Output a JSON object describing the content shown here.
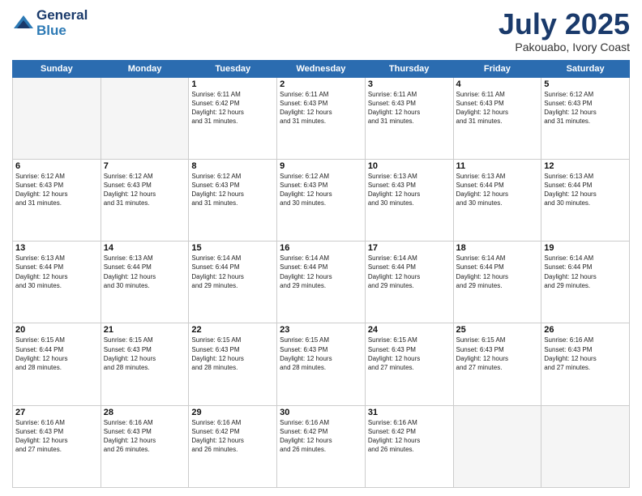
{
  "header": {
    "logo_line1": "General",
    "logo_line2": "Blue",
    "month_title": "July 2025",
    "location": "Pakouabo, Ivory Coast"
  },
  "weekdays": [
    "Sunday",
    "Monday",
    "Tuesday",
    "Wednesday",
    "Thursday",
    "Friday",
    "Saturday"
  ],
  "weeks": [
    [
      {
        "day": "",
        "empty": true
      },
      {
        "day": "",
        "empty": true
      },
      {
        "day": "1",
        "lines": [
          "Sunrise: 6:11 AM",
          "Sunset: 6:42 PM",
          "Daylight: 12 hours",
          "and 31 minutes."
        ]
      },
      {
        "day": "2",
        "lines": [
          "Sunrise: 6:11 AM",
          "Sunset: 6:43 PM",
          "Daylight: 12 hours",
          "and 31 minutes."
        ]
      },
      {
        "day": "3",
        "lines": [
          "Sunrise: 6:11 AM",
          "Sunset: 6:43 PM",
          "Daylight: 12 hours",
          "and 31 minutes."
        ]
      },
      {
        "day": "4",
        "lines": [
          "Sunrise: 6:11 AM",
          "Sunset: 6:43 PM",
          "Daylight: 12 hours",
          "and 31 minutes."
        ]
      },
      {
        "day": "5",
        "lines": [
          "Sunrise: 6:12 AM",
          "Sunset: 6:43 PM",
          "Daylight: 12 hours",
          "and 31 minutes."
        ]
      }
    ],
    [
      {
        "day": "6",
        "lines": [
          "Sunrise: 6:12 AM",
          "Sunset: 6:43 PM",
          "Daylight: 12 hours",
          "and 31 minutes."
        ]
      },
      {
        "day": "7",
        "lines": [
          "Sunrise: 6:12 AM",
          "Sunset: 6:43 PM",
          "Daylight: 12 hours",
          "and 31 minutes."
        ]
      },
      {
        "day": "8",
        "lines": [
          "Sunrise: 6:12 AM",
          "Sunset: 6:43 PM",
          "Daylight: 12 hours",
          "and 31 minutes."
        ]
      },
      {
        "day": "9",
        "lines": [
          "Sunrise: 6:12 AM",
          "Sunset: 6:43 PM",
          "Daylight: 12 hours",
          "and 30 minutes."
        ]
      },
      {
        "day": "10",
        "lines": [
          "Sunrise: 6:13 AM",
          "Sunset: 6:43 PM",
          "Daylight: 12 hours",
          "and 30 minutes."
        ]
      },
      {
        "day": "11",
        "lines": [
          "Sunrise: 6:13 AM",
          "Sunset: 6:44 PM",
          "Daylight: 12 hours",
          "and 30 minutes."
        ]
      },
      {
        "day": "12",
        "lines": [
          "Sunrise: 6:13 AM",
          "Sunset: 6:44 PM",
          "Daylight: 12 hours",
          "and 30 minutes."
        ]
      }
    ],
    [
      {
        "day": "13",
        "lines": [
          "Sunrise: 6:13 AM",
          "Sunset: 6:44 PM",
          "Daylight: 12 hours",
          "and 30 minutes."
        ]
      },
      {
        "day": "14",
        "lines": [
          "Sunrise: 6:13 AM",
          "Sunset: 6:44 PM",
          "Daylight: 12 hours",
          "and 30 minutes."
        ]
      },
      {
        "day": "15",
        "lines": [
          "Sunrise: 6:14 AM",
          "Sunset: 6:44 PM",
          "Daylight: 12 hours",
          "and 29 minutes."
        ]
      },
      {
        "day": "16",
        "lines": [
          "Sunrise: 6:14 AM",
          "Sunset: 6:44 PM",
          "Daylight: 12 hours",
          "and 29 minutes."
        ]
      },
      {
        "day": "17",
        "lines": [
          "Sunrise: 6:14 AM",
          "Sunset: 6:44 PM",
          "Daylight: 12 hours",
          "and 29 minutes."
        ]
      },
      {
        "day": "18",
        "lines": [
          "Sunrise: 6:14 AM",
          "Sunset: 6:44 PM",
          "Daylight: 12 hours",
          "and 29 minutes."
        ]
      },
      {
        "day": "19",
        "lines": [
          "Sunrise: 6:14 AM",
          "Sunset: 6:44 PM",
          "Daylight: 12 hours",
          "and 29 minutes."
        ]
      }
    ],
    [
      {
        "day": "20",
        "lines": [
          "Sunrise: 6:15 AM",
          "Sunset: 6:44 PM",
          "Daylight: 12 hours",
          "and 28 minutes."
        ]
      },
      {
        "day": "21",
        "lines": [
          "Sunrise: 6:15 AM",
          "Sunset: 6:43 PM",
          "Daylight: 12 hours",
          "and 28 minutes."
        ]
      },
      {
        "day": "22",
        "lines": [
          "Sunrise: 6:15 AM",
          "Sunset: 6:43 PM",
          "Daylight: 12 hours",
          "and 28 minutes."
        ]
      },
      {
        "day": "23",
        "lines": [
          "Sunrise: 6:15 AM",
          "Sunset: 6:43 PM",
          "Daylight: 12 hours",
          "and 28 minutes."
        ]
      },
      {
        "day": "24",
        "lines": [
          "Sunrise: 6:15 AM",
          "Sunset: 6:43 PM",
          "Daylight: 12 hours",
          "and 27 minutes."
        ]
      },
      {
        "day": "25",
        "lines": [
          "Sunrise: 6:15 AM",
          "Sunset: 6:43 PM",
          "Daylight: 12 hours",
          "and 27 minutes."
        ]
      },
      {
        "day": "26",
        "lines": [
          "Sunrise: 6:16 AM",
          "Sunset: 6:43 PM",
          "Daylight: 12 hours",
          "and 27 minutes."
        ]
      }
    ],
    [
      {
        "day": "27",
        "lines": [
          "Sunrise: 6:16 AM",
          "Sunset: 6:43 PM",
          "Daylight: 12 hours",
          "and 27 minutes."
        ]
      },
      {
        "day": "28",
        "lines": [
          "Sunrise: 6:16 AM",
          "Sunset: 6:43 PM",
          "Daylight: 12 hours",
          "and 26 minutes."
        ]
      },
      {
        "day": "29",
        "lines": [
          "Sunrise: 6:16 AM",
          "Sunset: 6:42 PM",
          "Daylight: 12 hours",
          "and 26 minutes."
        ]
      },
      {
        "day": "30",
        "lines": [
          "Sunrise: 6:16 AM",
          "Sunset: 6:42 PM",
          "Daylight: 12 hours",
          "and 26 minutes."
        ]
      },
      {
        "day": "31",
        "lines": [
          "Sunrise: 6:16 AM",
          "Sunset: 6:42 PM",
          "Daylight: 12 hours",
          "and 26 minutes."
        ]
      },
      {
        "day": "",
        "empty": true
      },
      {
        "day": "",
        "empty": true
      }
    ]
  ]
}
